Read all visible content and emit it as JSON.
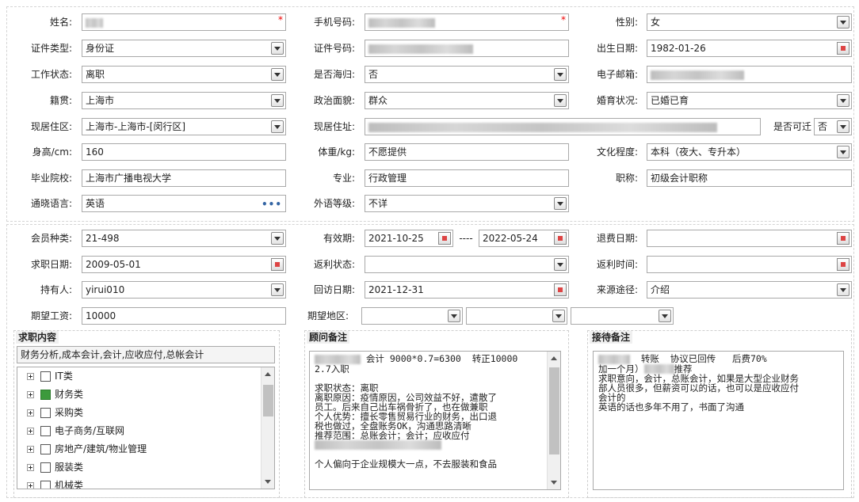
{
  "personal": {
    "name_label": "姓名:",
    "mobile_label": "手机号码:",
    "gender_label": "性别:",
    "gender_value": "女",
    "id_type_label": "证件类型:",
    "id_type_value": "身份证",
    "id_no_label": "证件号码:",
    "birth_label": "出生日期:",
    "birth_value": "1982-01-26",
    "work_status_label": "工作状态:",
    "work_status_value": "离职",
    "overseas_label": "是否海归:",
    "overseas_value": "否",
    "email_label": "电子邮箱:",
    "native_label": "籍贯:",
    "native_value": "上海市",
    "political_label": "政治面貌:",
    "political_value": "群众",
    "marital_label": "婚育状况:",
    "marital_value": "已婚已育",
    "residence_area_label": "现居住区:",
    "residence_area_value": "上海市-上海市-[闵行区]",
    "residence_addr_label": "现居住址:",
    "relocate_label": "是否可迁",
    "relocate_value": "否",
    "height_label": "身高/cm:",
    "height_value": "160",
    "weight_label": "体重/kg:",
    "weight_value": "不愿提供",
    "education_label": "文化程度:",
    "education_value": "本科（夜大、专升本）",
    "school_label": "毕业院校:",
    "school_value": "上海市广播电视大学",
    "major_label": "专业:",
    "major_value": "行政管理",
    "title_label": "职称:",
    "title_value": "初级会计职称",
    "language_label": "通晓语言:",
    "language_value": "英语",
    "lang_level_label": "外语等级:",
    "lang_level_value": "不详"
  },
  "membership": {
    "member_type_label": "会员种类:",
    "member_type_value": "21-498",
    "validity_label": "有效期:",
    "valid_from": "2021-10-25",
    "valid_sep": "----",
    "valid_to": "2022-05-24",
    "refund_date_label": "退费日期:",
    "job_date_label": "求职日期:",
    "job_date_value": "2009-05-01",
    "rebate_status_label": "返利状态:",
    "rebate_time_label": "返利时间:",
    "holder_label": "持有人:",
    "holder_value": "yirui010",
    "visit_date_label": "回访日期:",
    "visit_date_value": "2021-12-31",
    "source_label": "来源途径:",
    "source_value": "介绍",
    "salary_label": "期望工资:",
    "salary_value": "10000",
    "region_label": "期望地区:"
  },
  "job_content": {
    "title": "求职内容",
    "summary": "财务分析,成本会计,会计,应收应付,总帐会计",
    "tree": [
      {
        "label": "IT类",
        "checked": false
      },
      {
        "label": "财务类",
        "checked": true
      },
      {
        "label": "采购类",
        "checked": false
      },
      {
        "label": "电子商务/互联网",
        "checked": false
      },
      {
        "label": "房地产/建筑/物业管理",
        "checked": false
      },
      {
        "label": "服装类",
        "checked": false
      },
      {
        "label": "机械类",
        "checked": false
      }
    ]
  },
  "consultant_notes": {
    "title": "顾问备注",
    "line1": " 会计 9000*0.7=6300  转正10000",
    "line2": "2.7入职",
    "line3": "",
    "line4": "求职状态：离职",
    "line5": "离职原因：疫情原因，公司效益不好，遣散了",
    "line6": "员工。后来自己出车祸骨折了，也在做兼职",
    "line7": "个人优势：擅长零售贸易行业的财务，出口退",
    "line8": "税也做过，全盘账务OK，沟通思路清晰",
    "line9": "推荐范围：总账会计；会计；应收应付",
    "line10": "",
    "line11": "",
    "line12": "个人偏向于企业规模大一点，不去服装和食品"
  },
  "reception_notes": {
    "title": "接待备注",
    "line1": "  转账  协议已回传   后费70%",
    "line2": "加一个月）",
    "line2b": "推荐",
    "line3": "求职意向，会计，总账会计，如果是大型企业财务",
    "line4": "部人员很多，但薪资可以的话，也可以是应收应付",
    "line5": "会计的",
    "line6": "英语的话也多年不用了，书面了沟通"
  }
}
